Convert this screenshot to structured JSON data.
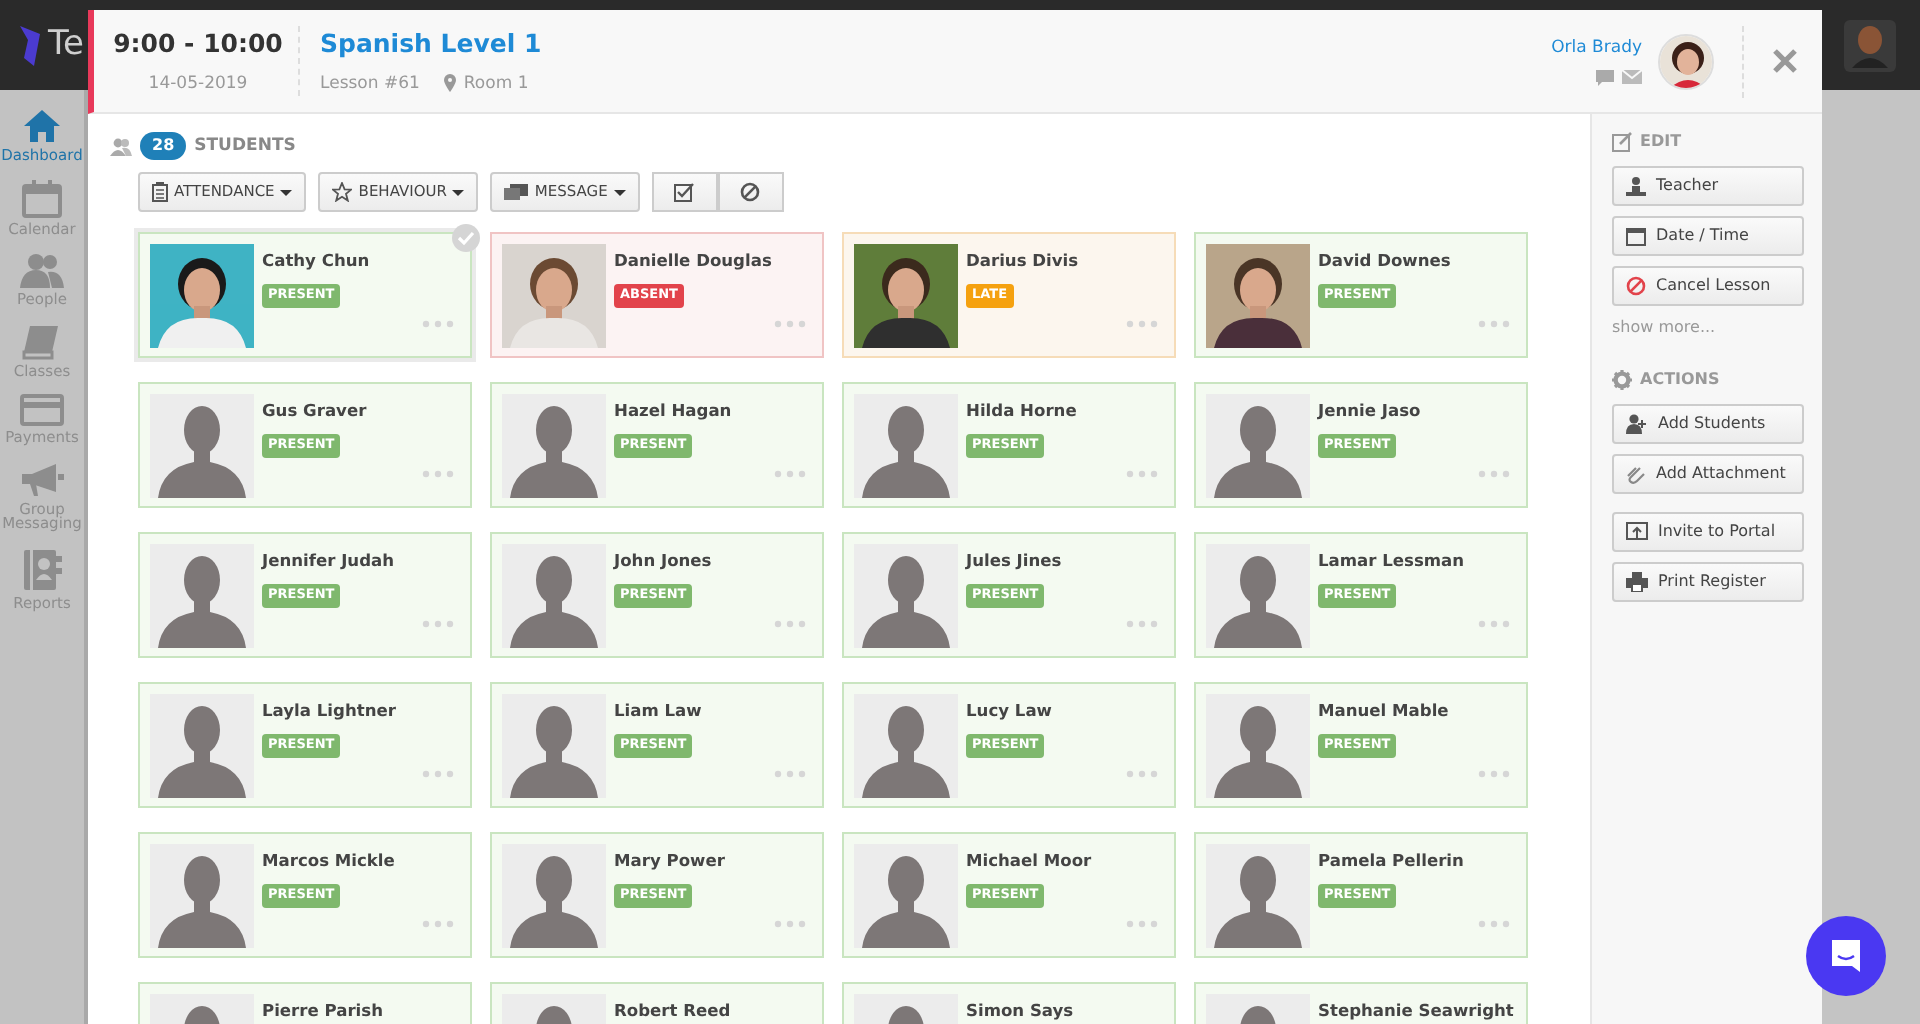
{
  "app": {
    "logo_text": "Te",
    "sidebar": [
      {
        "label": "Dashboard",
        "selected": true
      },
      {
        "label": "Calendar",
        "selected": false
      },
      {
        "label": "People",
        "selected": false
      },
      {
        "label": "Classes",
        "selected": false
      },
      {
        "label": "Payments",
        "selected": false
      },
      {
        "label": "Group Messaging",
        "selected": false
      },
      {
        "label": "Reports",
        "selected": false
      }
    ]
  },
  "lesson": {
    "time": "9:00 - 10:00",
    "date": "14-05-2019",
    "title": "Spanish Level 1",
    "lesson_number": "Lesson #61",
    "room": "Room 1",
    "teacher": "Orla Brady"
  },
  "students_header": {
    "count": "28",
    "label": "STUDENTS"
  },
  "toolbar": [
    {
      "kind": "dropdown",
      "label": "ATTENDANCE"
    },
    {
      "kind": "dropdown",
      "label": "BEHAVIOUR"
    },
    {
      "kind": "dropdown",
      "label": "MESSAGE"
    },
    {
      "kind": "icon"
    },
    {
      "kind": "icon"
    }
  ],
  "students": [
    {
      "name": "Cathy Chun",
      "status": {
        "label": "PRESENT",
        "kind": "present"
      },
      "selected": true
    },
    {
      "name": "Danielle Douglas",
      "status": {
        "label": "ABSENT",
        "kind": "absent"
      },
      "selected": false
    },
    {
      "name": "Darius Divis",
      "status": {
        "label": "LATE",
        "kind": "late"
      },
      "selected": false
    },
    {
      "name": "David Downes",
      "status": {
        "label": "PRESENT",
        "kind": "present"
      },
      "selected": false
    },
    {
      "name": "Gus Graver",
      "status": {
        "label": "PRESENT",
        "kind": "present"
      },
      "avatar": {
        "kind": "silhouette"
      },
      "selected": false
    },
    {
      "name": "Hazel Hagan",
      "status": {
        "label": "PRESENT",
        "kind": "present"
      },
      "avatar": {
        "kind": "silhouette"
      },
      "selected": false
    },
    {
      "name": "Hilda Horne",
      "status": {
        "label": "PRESENT",
        "kind": "present"
      },
      "avatar": {
        "kind": "silhouette"
      },
      "selected": false
    },
    {
      "name": "Jennie Jaso",
      "status": {
        "label": "PRESENT",
        "kind": "present"
      },
      "avatar": {
        "kind": "silhouette"
      },
      "selected": false
    },
    {
      "name": "Jennifer Judah",
      "status": {
        "label": "PRESENT",
        "kind": "present"
      },
      "avatar": {
        "kind": "silhouette"
      },
      "selected": false
    },
    {
      "name": "John Jones",
      "status": {
        "label": "PRESENT",
        "kind": "present"
      },
      "avatar": {
        "kind": "silhouette"
      },
      "selected": false
    },
    {
      "name": "Jules Jines",
      "status": {
        "label": "PRESENT",
        "kind": "present"
      },
      "avatar": {
        "kind": "silhouette"
      },
      "selected": false
    },
    {
      "name": "Lamar Lessman",
      "status": {
        "label": "PRESENT",
        "kind": "present"
      },
      "avatar": {
        "kind": "silhouette"
      },
      "selected": false
    },
    {
      "name": "Layla Lightner",
      "status": {
        "label": "PRESENT",
        "kind": "present"
      },
      "avatar": {
        "kind": "silhouette"
      },
      "selected": false
    },
    {
      "name": "Liam Law",
      "status": {
        "label": "PRESENT",
        "kind": "present"
      },
      "avatar": {
        "kind": "silhouette"
      },
      "selected": false
    },
    {
      "name": "Lucy Law",
      "status": {
        "label": "PRESENT",
        "kind": "present"
      },
      "avatar": {
        "kind": "silhouette"
      },
      "selected": false
    },
    {
      "name": "Manuel Mable",
      "status": {
        "label": "PRESENT",
        "kind": "present"
      },
      "avatar": {
        "kind": "silhouette"
      },
      "selected": false
    },
    {
      "name": "Marcos Mickle",
      "status": {
        "label": "PRESENT",
        "kind": "present"
      },
      "avatar": {
        "kind": "silhouette"
      },
      "selected": false
    },
    {
      "name": "Mary Power",
      "status": {
        "label": "PRESENT",
        "kind": "present"
      },
      "avatar": {
        "kind": "silhouette"
      },
      "selected": false
    },
    {
      "name": "Michael Moor",
      "status": {
        "label": "PRESENT",
        "kind": "present"
      },
      "avatar": {
        "kind": "silhouette"
      },
      "selected": false
    },
    {
      "name": "Pamela Pellerin",
      "status": {
        "label": "PRESENT",
        "kind": "present"
      },
      "avatar": {
        "kind": "silhouette"
      },
      "selected": false
    },
    {
      "name": "Pierre Parish",
      "status": {
        "kind": "present"
      },
      "avatar": {
        "kind": "silhouette"
      },
      "selected": false
    },
    {
      "name": "Robert Reed",
      "status": {
        "kind": "present"
      },
      "avatar": {
        "kind": "silhouette"
      },
      "selected": false
    },
    {
      "name": "Simon Says",
      "status": {
        "kind": "present"
      },
      "avatar": {
        "kind": "silhouette"
      },
      "selected": false
    },
    {
      "name": "Stephanie Seawright",
      "status": {
        "kind": "present"
      },
      "avatar": {
        "kind": "silhouette"
      },
      "selected": false
    }
  ],
  "edit": {
    "heading": "EDIT",
    "buttons": [
      "Teacher",
      "Date / Time",
      "Cancel Lesson"
    ],
    "show_more": "show more..."
  },
  "actions": {
    "heading": "ACTIONS",
    "buttons": [
      "Add Students",
      "Add Attachment",
      "Invite to Portal",
      "Print Register"
    ]
  }
}
